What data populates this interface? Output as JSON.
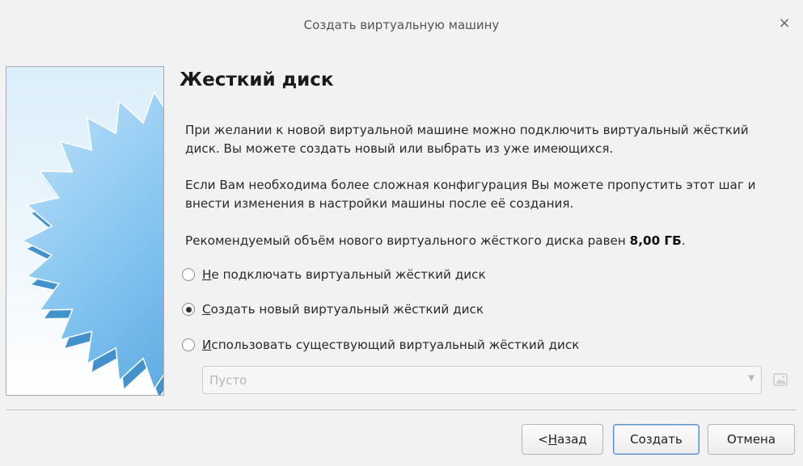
{
  "window": {
    "title": "Создать виртуальную машину",
    "close_glyph": "×"
  },
  "page": {
    "title": "Жесткий диск",
    "paragraph1": "При желании к новой виртуальной машине можно подключить виртуальный жёсткий диск. Вы можете создать новый или выбрать из уже имеющихся.",
    "paragraph2": "Если Вам необходима более сложная конфигурация Вы можете пропустить этот шаг и внести изменения в настройки машины после её создания.",
    "recommended_prefix": "Рекомендуемый объём нового виртуального жёсткого диска равен ",
    "recommended_size": "8,00 ГБ",
    "recommended_suffix": "."
  },
  "options": [
    {
      "mnemonic": "Н",
      "rest": "е подключать виртуальный жёсткий диск",
      "checked": false
    },
    {
      "mnemonic": "С",
      "rest": "оздать новый виртуальный жёсткий диск",
      "checked": true
    },
    {
      "mnemonic": "И",
      "rest": "спользовать существующий виртуальный жёсткий диск",
      "checked": false
    }
  ],
  "disk_selector": {
    "value": "Пусто",
    "enabled": false,
    "icon": "folder-open-icon"
  },
  "buttons": {
    "back_prefix": "< ",
    "back_mnemonic": "Н",
    "back_rest": "азад",
    "create": "Создать",
    "cancel": "Отмена"
  },
  "colors": {
    "background": "#f2f2f2",
    "star_fill": "#6fb6e8",
    "star_edge": "#2f86c6",
    "default_button_border": "#5b8fc9"
  }
}
